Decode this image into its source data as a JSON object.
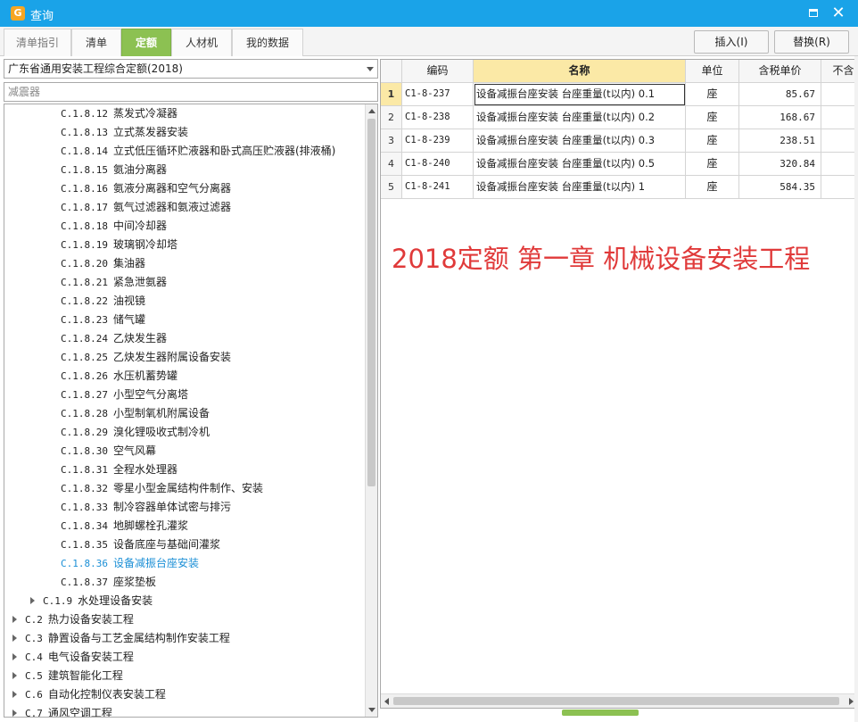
{
  "window": {
    "title": "查询",
    "app_icon": "app-logo-icon",
    "maximize_icon": "maximize-icon",
    "close_symbol": "✕"
  },
  "tabs": [
    {
      "label": "清单指引"
    },
    {
      "label": "清单"
    },
    {
      "label": "定额"
    },
    {
      "label": "人材机"
    },
    {
      "label": "我的数据"
    }
  ],
  "toolbar": {
    "insert_label": "插入(I)",
    "replace_label": "替换(R)"
  },
  "left": {
    "quota_library": "广东省通用安装工程综合定额(2018)",
    "search_value": "减震器",
    "tree": [
      {
        "code": "C.1.8.12",
        "label": "蒸发式冷凝器"
      },
      {
        "code": "C.1.8.13",
        "label": "立式蒸发器安装"
      },
      {
        "code": "C.1.8.14",
        "label": "立式低压循环贮液器和卧式高压贮液器(排液桶)"
      },
      {
        "code": "C.1.8.15",
        "label": "氨油分离器"
      },
      {
        "code": "C.1.8.16",
        "label": "氨液分离器和空气分离器"
      },
      {
        "code": "C.1.8.17",
        "label": "氨气过滤器和氨液过滤器"
      },
      {
        "code": "C.1.8.18",
        "label": "中间冷却器"
      },
      {
        "code": "C.1.8.19",
        "label": "玻璃钢冷却塔"
      },
      {
        "code": "C.1.8.20",
        "label": "集油器"
      },
      {
        "code": "C.1.8.21",
        "label": "紧急泄氨器"
      },
      {
        "code": "C.1.8.22",
        "label": "油视镜"
      },
      {
        "code": "C.1.8.23",
        "label": "储气罐"
      },
      {
        "code": "C.1.8.24",
        "label": "乙炔发生器"
      },
      {
        "code": "C.1.8.25",
        "label": "乙炔发生器附属设备安装"
      },
      {
        "code": "C.1.8.26",
        "label": "水压机蓄势罐"
      },
      {
        "code": "C.1.8.27",
        "label": "小型空气分离塔"
      },
      {
        "code": "C.1.8.28",
        "label": "小型制氧机附属设备"
      },
      {
        "code": "C.1.8.29",
        "label": "溴化锂吸收式制冷机"
      },
      {
        "code": "C.1.8.30",
        "label": "空气风幕"
      },
      {
        "code": "C.1.8.31",
        "label": "全程水处理器"
      },
      {
        "code": "C.1.8.32",
        "label": "零星小型金属结构件制作、安装"
      },
      {
        "code": "C.1.8.33",
        "label": "制冷容器单体试密与排污"
      },
      {
        "code": "C.1.8.34",
        "label": "地脚螺栓孔灌浆"
      },
      {
        "code": "C.1.8.35",
        "label": "设备底座与基础间灌浆"
      },
      {
        "code": "C.1.8.36",
        "label": "设备减振台座安装"
      },
      {
        "code": "C.1.8.37",
        "label": "座浆垫板"
      },
      {
        "code": "C.1.9",
        "label": "水处理设备安装"
      },
      {
        "code": "C.2",
        "label": "热力设备安装工程"
      },
      {
        "code": "C.3",
        "label": "静置设备与工艺金属结构制作安装工程"
      },
      {
        "code": "C.4",
        "label": "电气设备安装工程"
      },
      {
        "code": "C.5",
        "label": "建筑智能化工程"
      },
      {
        "code": "C.6",
        "label": "自动化控制仪表安装工程"
      },
      {
        "code": "C.7",
        "label": "通风空调工程"
      }
    ]
  },
  "grid": {
    "headers": [
      "编码",
      "名称",
      "单位",
      "含税单价",
      "不含"
    ],
    "rows": [
      {
        "idx": "1",
        "code": "C1-8-237",
        "name": "设备减振台座安装 台座重量(t以内) 0.1",
        "unit": "座",
        "price": "85.67"
      },
      {
        "idx": "2",
        "code": "C1-8-238",
        "name": "设备减振台座安装 台座重量(t以内) 0.2",
        "unit": "座",
        "price": "168.67"
      },
      {
        "idx": "3",
        "code": "C1-8-239",
        "name": "设备减振台座安装 台座重量(t以内) 0.3",
        "unit": "座",
        "price": "238.51"
      },
      {
        "idx": "4",
        "code": "C1-8-240",
        "name": "设备减振台座安装 台座重量(t以内) 0.5",
        "unit": "座",
        "price": "320.84"
      },
      {
        "idx": "5",
        "code": "C1-8-241",
        "name": "设备减振台座安装 台座重量(t以内) 1",
        "unit": "座",
        "price": "584.35"
      }
    ]
  },
  "annotation": "2018定额  第一章  机械设备安装工程",
  "colors": {
    "titlebar": "#1aa3e8",
    "active_tab": "#8cc152",
    "selected_tree_item": "#1b8fd6",
    "header_highlight": "#fbe9a6",
    "annotation": "#e03a3a"
  }
}
